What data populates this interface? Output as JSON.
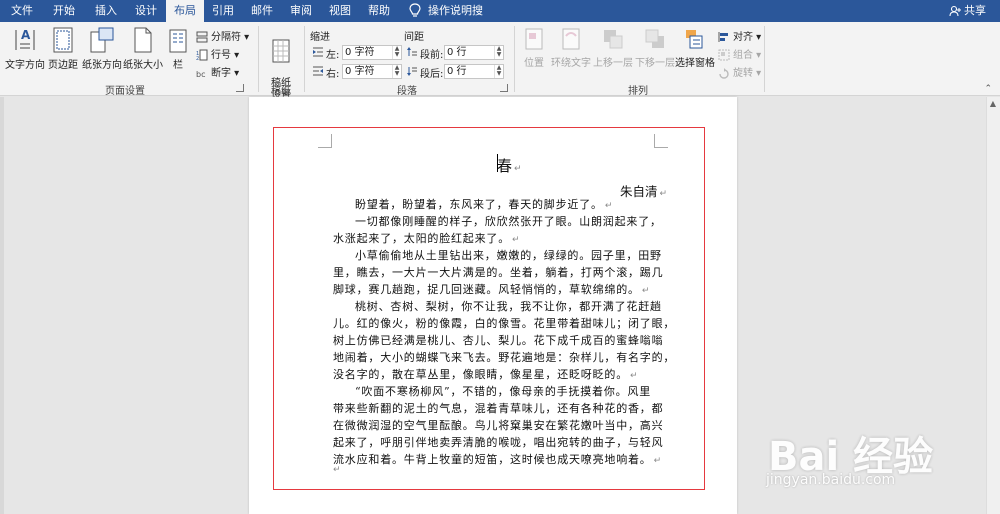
{
  "tabs": [
    {
      "label": "文件",
      "active": false
    },
    {
      "label": "开始",
      "active": false
    },
    {
      "label": "插入",
      "active": false
    },
    {
      "label": "设计",
      "active": false
    },
    {
      "label": "布局",
      "active": true
    },
    {
      "label": "引用",
      "active": false
    },
    {
      "label": "邮件",
      "active": false
    },
    {
      "label": "审阅",
      "active": false
    },
    {
      "label": "视图",
      "active": false
    },
    {
      "label": "帮助",
      "active": false
    }
  ],
  "tell_me": "操作说明搜索",
  "share": "共享",
  "ribbon": {
    "page_setup": {
      "label": "页面设置",
      "text_direction": "文字方向",
      "margins": "页边距",
      "orientation": "纸张方向",
      "size": "纸张大小",
      "columns": "栏",
      "breaks": "分隔符",
      "line_numbers": "行号",
      "hyphenation": "断字"
    },
    "manuscript": {
      "label": "稿纸",
      "button": "稿纸\n设置"
    },
    "paragraph": {
      "label": "段落",
      "indent": "缩进",
      "spacing": "间距",
      "left_label": "左:",
      "left_value": "0 字符",
      "right_label": "右:",
      "right_value": "0 字符",
      "before_label": "段前:",
      "before_value": "0 行",
      "after_label": "段后:",
      "after_value": "0 行"
    },
    "arrange": {
      "label": "排列",
      "position": "位置",
      "wrap_text": "环绕文字",
      "bring_forward": "上移一层",
      "send_backward": "下移一层",
      "selection_pane": "选择窗格",
      "align": "对齐",
      "group": "组合",
      "rotate": "旋转"
    }
  },
  "document": {
    "title": "春",
    "author": "朱自清",
    "lines": [
      "盼望着，盼望着，东风来了，春天的脚步近了。",
      "一切都像刚睡醒的样子，欣欣然张开了眼。山朗润起来了，",
      "水涨起来了，太阳的脸红起来了。",
      "小草偷偷地从土里钻出来，嫩嫩的，绿绿的。园子里，田野",
      "里，瞧去，一大片一大片满是的。坐着，躺着，打两个滚，踢几",
      "脚球，赛几趟跑，捉几回迷藏。风轻悄悄的，草软绵绵的。",
      "桃树、杏树、梨树，你不让我，我不让你，都开满了花赶趟",
      "儿。红的像火，粉的像霞，白的像雪。花里带着甜味儿；闭了眼，",
      "树上仿佛已经满是桃儿、杏儿、梨儿。花下成千成百的蜜蜂嗡嗡",
      "地闹着，大小的蝴蝶飞来飞去。野花遍地是：杂样儿，有名字的，",
      "没名字的，散在草丛里，像眼睛，像星星，还眨呀眨的。",
      "“吹面不寒杨柳风”，不错的，像母亲的手抚摸着你。风里",
      "带来些新翻的泥土的气息，混着青草味儿，还有各种花的香，都",
      "在微微润湿的空气里酝酿。鸟儿将窠巢安在繁花嫩叶当中，高兴",
      "起来了，呼朋引伴地卖弄清脆的喉咙，唱出宛转的曲子，与轻风",
      "流水应和着。牛背上牧童的短笛，这时候也成天嘹亮地响着。"
    ]
  },
  "watermark": {
    "logo": "Bai 经验",
    "url": "jingyan.baidu.com"
  },
  "colors": {
    "tabbar": "#2b579a",
    "ribbon": "#f3f3f3",
    "highlight_box": "#e5393f"
  }
}
